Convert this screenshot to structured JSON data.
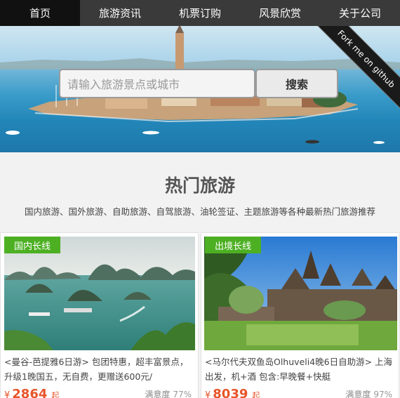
{
  "nav": {
    "items": [
      {
        "label": "首页",
        "active": true
      },
      {
        "label": "旅游资讯",
        "active": false
      },
      {
        "label": "机票订购",
        "active": false
      },
      {
        "label": "风景欣赏",
        "active": false
      },
      {
        "label": "关于公司",
        "active": false
      }
    ]
  },
  "hero": {
    "ribbon_text": "Fork me on github",
    "search_placeholder": "请输入旅游景点或城市",
    "search_button": "搜索"
  },
  "section": {
    "title": "热门旅游",
    "subtitle": "国内旅游、国外旅游、自助旅游、自驾旅游、油轮签证、主题旅游等各种最新热门旅游推荐"
  },
  "cards": [
    {
      "tag": "国内长线",
      "description": "<曼谷-芭提雅6日游> 包团特惠，超丰富景点，升级1晚国五，无自费，更赠送600元/",
      "currency": "¥",
      "price": "2864",
      "price_suffix": "起",
      "satisfaction_label": "满意度",
      "satisfaction": "77%"
    },
    {
      "tag": "出境长线",
      "description": "<马尔代夫双鱼岛Olhuveli4晚6日自助游> 上海出发，机+酒 包含:早晚餐+快艇",
      "currency": "¥",
      "price": "8039",
      "price_suffix": "起",
      "satisfaction_label": "满意度",
      "satisfaction": "97%"
    }
  ],
  "colors": {
    "nav_bg": "#3a3a3a",
    "nav_active": "#111111",
    "tag_green": "#4db023",
    "price_orange": "#e8542a"
  }
}
